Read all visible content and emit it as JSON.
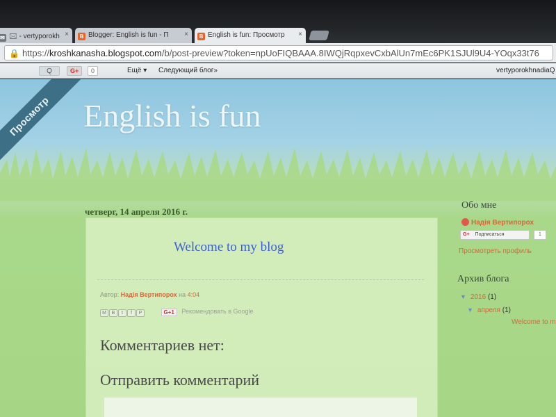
{
  "browser": {
    "tabs": [
      {
        "label": "🖂 - vertyporokh",
        "active": false,
        "icon": "gmail-icon"
      },
      {
        "label": "Blogger: English is fun - П",
        "active": false,
        "icon": "blogger-icon"
      },
      {
        "label": "English is fun: Просмотр",
        "active": true,
        "icon": "blogger-icon"
      }
    ],
    "close_glyph": "×",
    "address": {
      "scheme": "https://",
      "host": "kroshkanasha.blogspot.com",
      "path": "/b/post-preview?token=npUoFIQBAAA.8IWQjRqpxevCxbAlUn7mEc6PK1SJUl9U4-YOqx33t76"
    }
  },
  "navbar": {
    "search_glyph": "Q",
    "gplus_label": "G+",
    "gplus_count": "0",
    "more_label": "Ещё ▾",
    "next_blog_label": "Следующий блог»",
    "user_label": "vertyporokhnadiaQ"
  },
  "blog": {
    "preview_ribbon": "Просмотр",
    "title": "English is fun",
    "date_header": "четверг, 14 апреля 2016 г.",
    "post": {
      "title": "Welcome to my blog",
      "author_prefix": "Автор:",
      "author": "Надія Вертипорох",
      "time_prefix": "на",
      "time": "4:04",
      "share_buttons": [
        "M",
        "B",
        "t",
        "f",
        "P"
      ],
      "gplus_share": "G+1",
      "recommend_text": "Рекомендовать в Google"
    },
    "comments_heading": "Комментариев нет:",
    "post_comment_heading": "Отправить комментарий"
  },
  "sidebar": {
    "about_heading": "Обо мне",
    "profile_name": "Надія Вертипорох",
    "follow_gplus": "G+",
    "follow_label": "Подписаться",
    "follow_count": "1",
    "view_profile": "Просмотреть профиль",
    "archive_heading": "Архив блога",
    "archive_year": "2016",
    "archive_year_count": "(1)",
    "archive_month": "апреля",
    "archive_month_count": "(1)",
    "archive_post": "Welcome to m"
  },
  "colors": {
    "link_orange": "#d2693a",
    "post_title_blue": "#3a5fd0",
    "ribbon": "#3d6f87"
  }
}
